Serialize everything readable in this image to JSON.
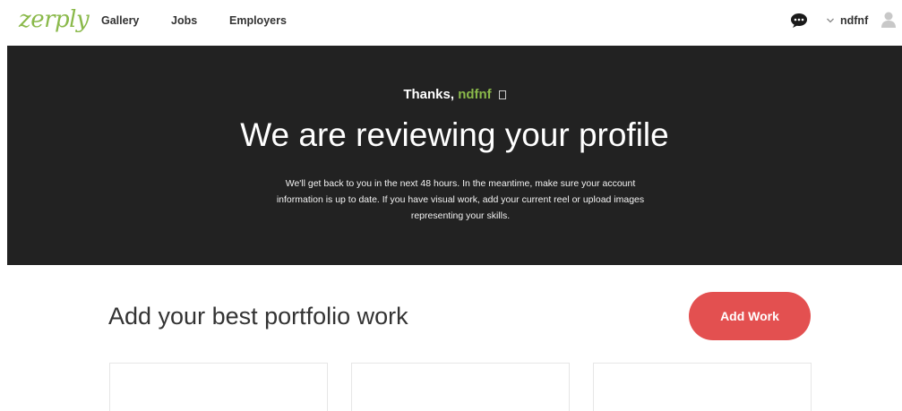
{
  "nav": {
    "logo": "zerply",
    "links": [
      "Gallery",
      "Jobs",
      "Employers"
    ],
    "username": "ndfnf",
    "icons": [
      "chat-bubble-icon",
      "chevron-down-icon",
      "user-avatar-icon"
    ]
  },
  "hero": {
    "thanks_prefix": "Thanks,",
    "thanks_name": "ndfnf",
    "title": "We are reviewing your profile",
    "body": "We'll get back to you in the next 48 hours. In the meantime, make sure your account information is up to date. If you have visual work, add your current reel or upload images representing your skills."
  },
  "portfolio": {
    "heading": "Add your best portfolio work",
    "add_button": "Add Work"
  },
  "colors": {
    "brand_green": "#8ab94a",
    "hero_bg": "#222222",
    "add_button_bg": "#e35050"
  }
}
